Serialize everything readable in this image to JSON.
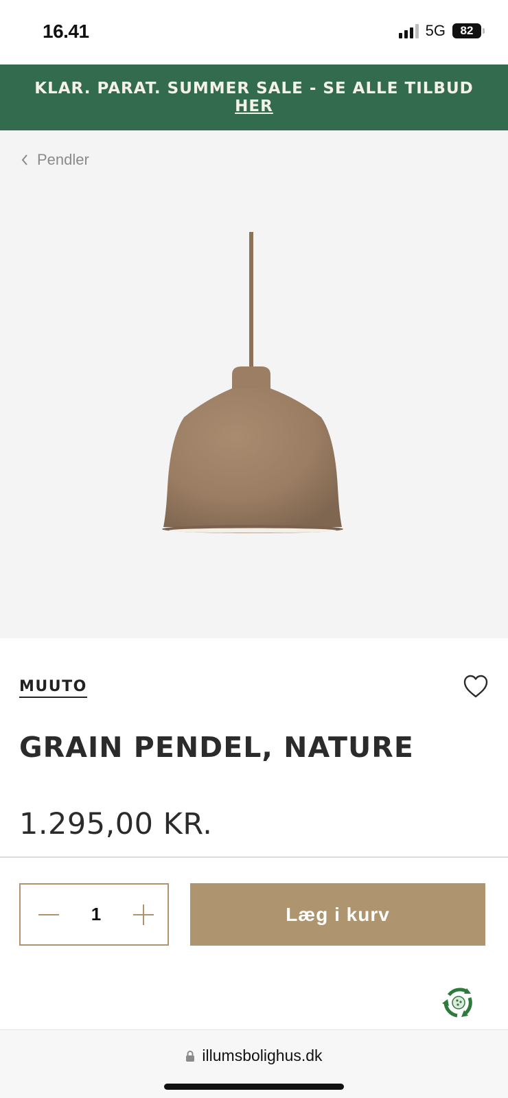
{
  "status_bar": {
    "time": "16.41",
    "network": "5G",
    "battery": "82"
  },
  "promo": {
    "text": "KLAR. PARAT. SUMMER SALE - SE ALLE TILBUD",
    "link": "HER",
    "background": "#336b4f"
  },
  "breadcrumb": {
    "label": "Pendler"
  },
  "product": {
    "brand": "MUUTO",
    "title": "GRAIN PENDEL, NATURE",
    "price": "1.295,00 KR.",
    "quantity": "1",
    "add_to_cart": "Læg i kurv",
    "accent": "#ae946f"
  },
  "browser": {
    "url": "illumsbolighus.dk"
  },
  "icons": {
    "back": "chevron-left-icon",
    "wishlist": "heart-icon",
    "decrease": "minus-icon",
    "increase": "plus-icon",
    "eco": "recycle-badge-icon",
    "secure": "lock-icon"
  }
}
